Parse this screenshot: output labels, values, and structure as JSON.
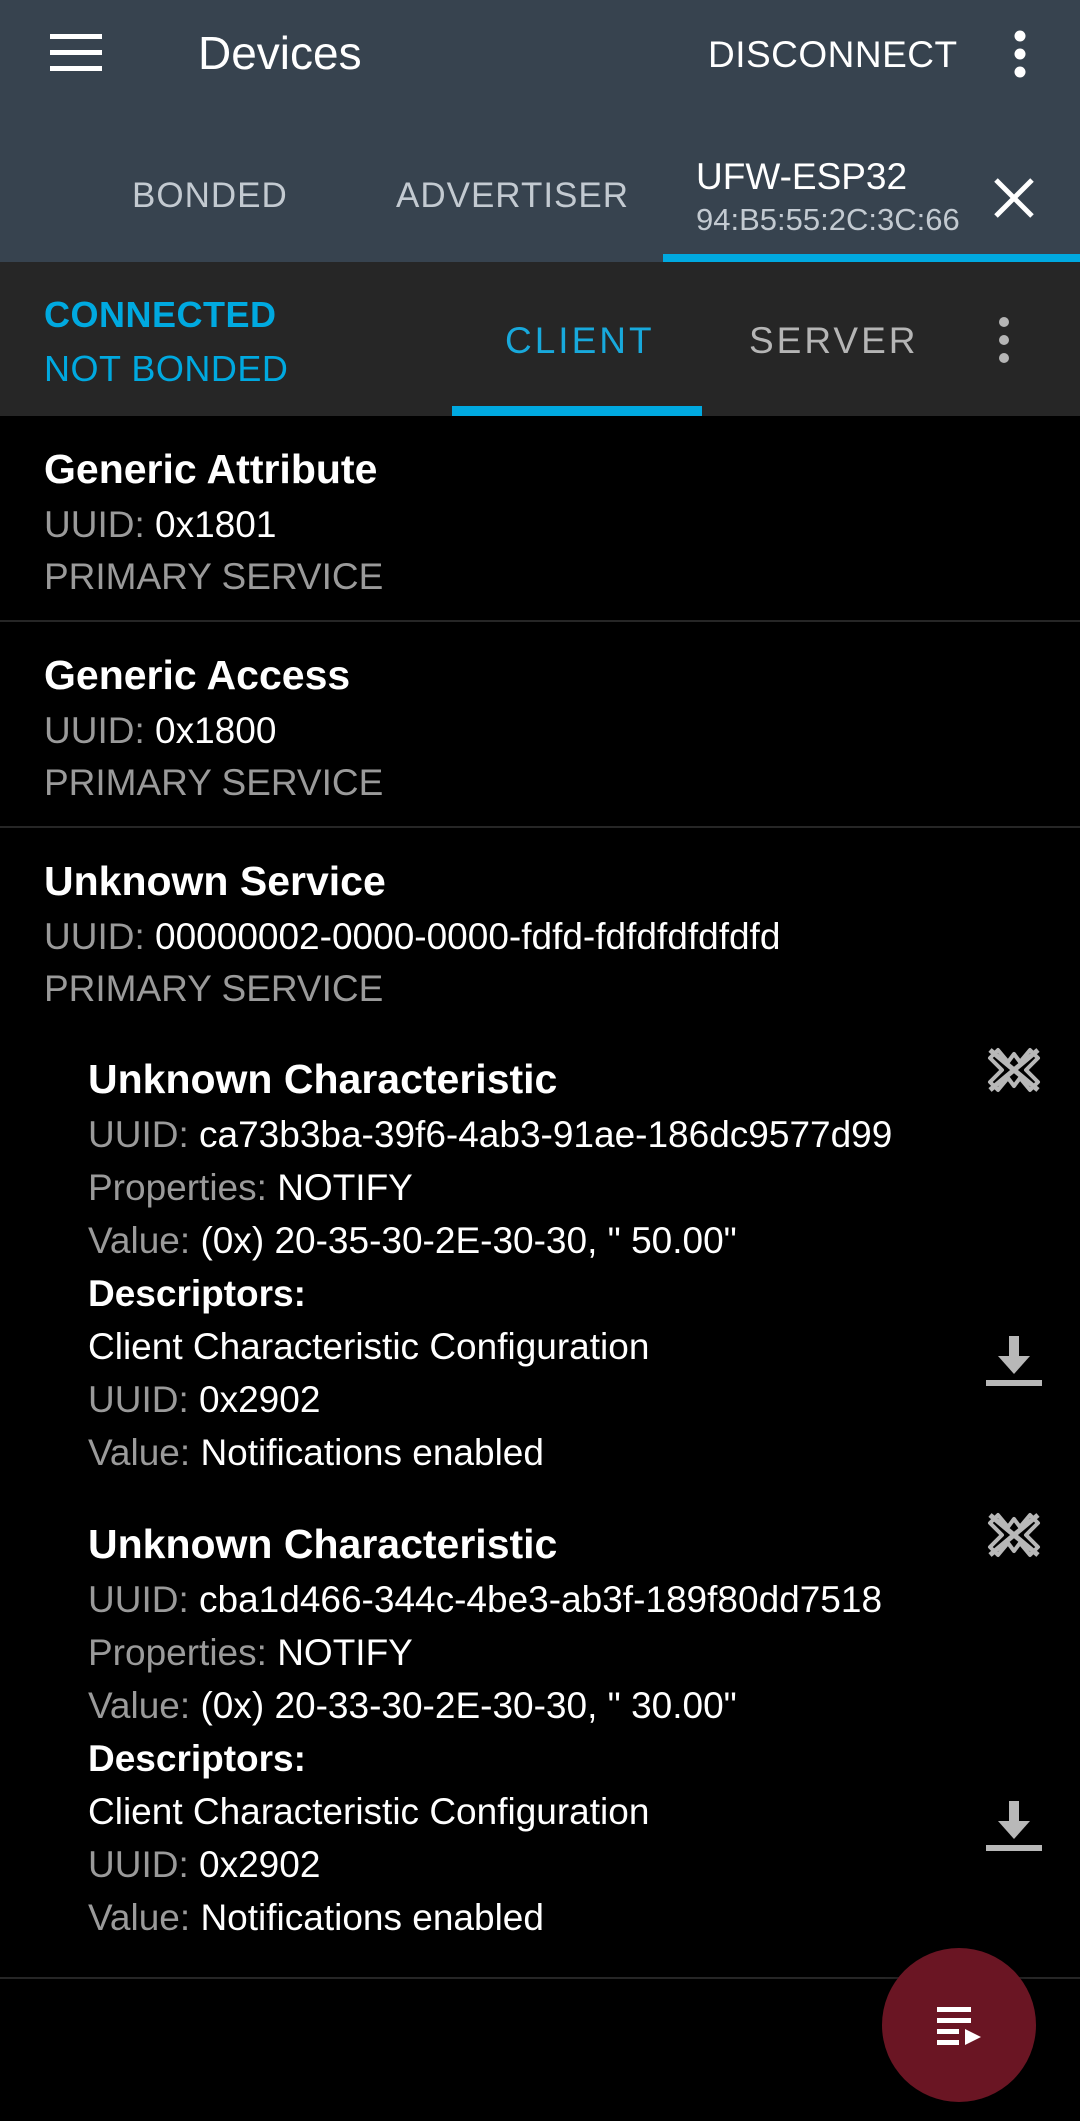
{
  "toolbar": {
    "title": "Devices",
    "disconnect_label": "DISCONNECT",
    "menu_icon": "menu-icon",
    "overflow_icon": "more-vert-icon"
  },
  "tabs": {
    "bonded": "BONDED",
    "advertiser": "ADVERTISER",
    "device_name": "UFW-ESP32",
    "device_address": "94:B5:55:2C:3C:66",
    "close_icon": "close-icon"
  },
  "connection": {
    "state": "CONNECTED",
    "bond": "NOT BONDED"
  },
  "subtabs": {
    "client": "CLIENT",
    "server": "SERVER"
  },
  "colors": {
    "toolbar_bg": "#37434f",
    "accent": "#00a9e0",
    "fab": "#6a1523"
  },
  "labels": {
    "uuid": "UUID:",
    "properties": "Properties:",
    "value": "Value:",
    "descriptors": "Descriptors:"
  },
  "services": [
    {
      "name": "Generic Attribute",
      "uuid": "0x1801",
      "type": "PRIMARY SERVICE"
    },
    {
      "name": "Generic Access",
      "uuid": "0x1800",
      "type": "PRIMARY SERVICE"
    },
    {
      "name": "Unknown Service",
      "uuid": "00000002-0000-0000-fdfd-fdfdfdfdfdfd",
      "type": "PRIMARY SERVICE",
      "characteristics": [
        {
          "name": "Unknown Characteristic",
          "uuid": "ca73b3ba-39f6-4ab3-91ae-186dc9577d99",
          "properties": "NOTIFY",
          "value": "(0x) 20-35-30-2E-30-30, \" 50.00\"",
          "descriptor": {
            "name": "Client Characteristic Configuration",
            "uuid": "0x2902",
            "value": "Notifications enabled"
          }
        },
        {
          "name": "Unknown Characteristic",
          "uuid": "cba1d466-344c-4be3-ab3f-189f80dd7518",
          "properties": "NOTIFY",
          "value": "(0x) 20-33-30-2E-30-30, \" 30.00\"",
          "descriptor": {
            "name": "Client Characteristic Configuration",
            "uuid": "0x2902",
            "value": "Notifications enabled"
          }
        }
      ]
    }
  ],
  "fab_icon": "log-playlist-icon"
}
